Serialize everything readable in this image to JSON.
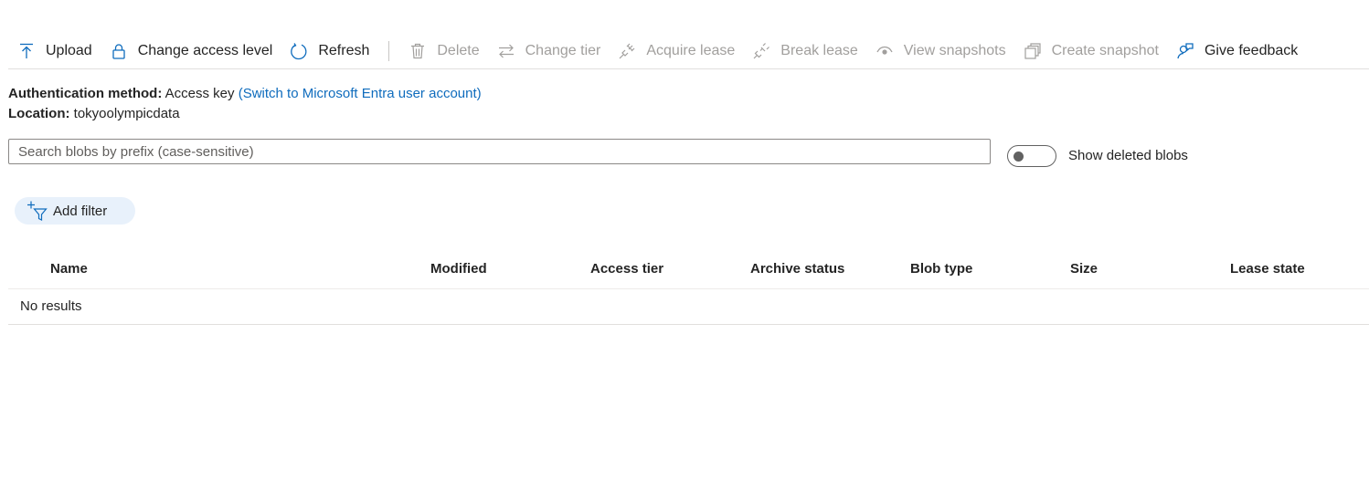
{
  "toolbar": {
    "upload": "Upload",
    "change_access_level": "Change access level",
    "refresh": "Refresh",
    "delete": "Delete",
    "change_tier": "Change tier",
    "acquire_lease": "Acquire lease",
    "break_lease": "Break lease",
    "view_snapshots": "View snapshots",
    "create_snapshot": "Create snapshot",
    "give_feedback": "Give feedback"
  },
  "info": {
    "auth_label": "Authentication method:",
    "auth_value": "Access key",
    "auth_link": "(Switch to Microsoft Entra user account)",
    "location_label": "Location:",
    "location_value": "tokyoolympicdata"
  },
  "search": {
    "placeholder": "Search blobs by prefix (case-sensitive)",
    "value": ""
  },
  "toggle": {
    "label": "Show deleted blobs",
    "on": false
  },
  "filter": {
    "add_label": "Add filter"
  },
  "table": {
    "columns": [
      "Name",
      "Modified",
      "Access tier",
      "Archive status",
      "Blob type",
      "Size",
      "Lease state"
    ],
    "empty_text": "No results"
  },
  "colors": {
    "accent": "#0f6cbd",
    "disabled": "#a19f9d",
    "pill_bg": "#e8f1fb"
  }
}
